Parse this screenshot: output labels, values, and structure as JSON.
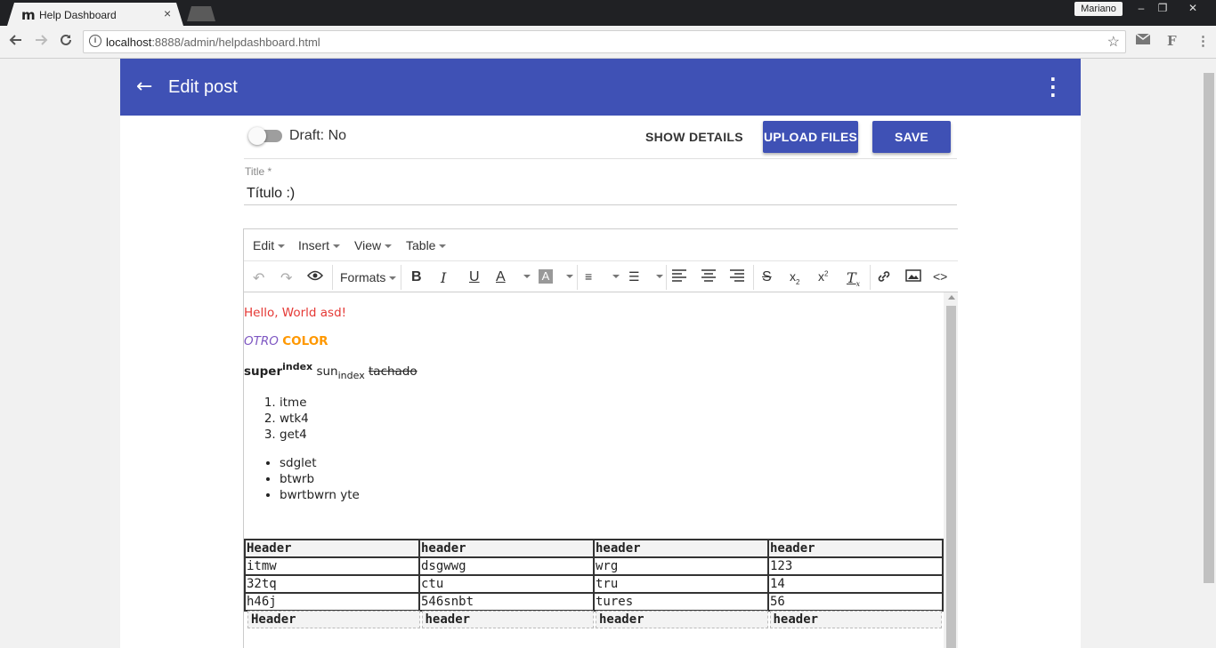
{
  "browser": {
    "tab_favicon": "m",
    "tab_title": "Help Dashboard",
    "tab_close": "×",
    "user_name": "Mariano",
    "url_host": "localhost",
    "url_rest": ":8888/admin/helpdashboard.html",
    "win_min": "–",
    "win_restore": "❐",
    "win_close": "✕"
  },
  "appbar": {
    "title": "Edit post",
    "back_icon": "←",
    "more_icon": "⋮"
  },
  "actions": {
    "draft_label": "Draft: No",
    "show_details": "SHOW DETAILS",
    "upload_files": "UPLOAD FILES",
    "save": "SAVE"
  },
  "title_field": {
    "label": "Title *",
    "value": "Título :)"
  },
  "editor": {
    "menus": [
      "Edit",
      "Insert",
      "View",
      "Table"
    ],
    "formats_label": "Formats",
    "content": {
      "p1": "Hello, World asd!",
      "p2_a": "OTRO",
      "p2_b": "COLOR",
      "p3_super": "super",
      "p3_sup": "index",
      "p3_sun": "sun",
      "p3_sub": "index",
      "p3_strike": "tachado",
      "ordered": [
        "itme",
        "wtk4",
        "get4"
      ],
      "bullets": [
        "sdglet",
        "btwrb",
        "bwrtbwrn yte"
      ],
      "table1": {
        "header": [
          "Header",
          "header",
          "header",
          "header"
        ],
        "rows": [
          [
            "itmw",
            "dsgwwg",
            "wrg",
            "123"
          ],
          [
            "32tq",
            "ctu",
            "tru",
            "14"
          ],
          [
            "h46j",
            "546snbt",
            "tures",
            "56"
          ]
        ]
      },
      "table2": {
        "header": [
          "Header",
          "header",
          "header",
          "header"
        ]
      }
    }
  },
  "colors": {
    "primary": "#3f51b5",
    "red_text": "#e53935",
    "purple_text": "#7e57c2",
    "orange_text": "#ff9800"
  }
}
